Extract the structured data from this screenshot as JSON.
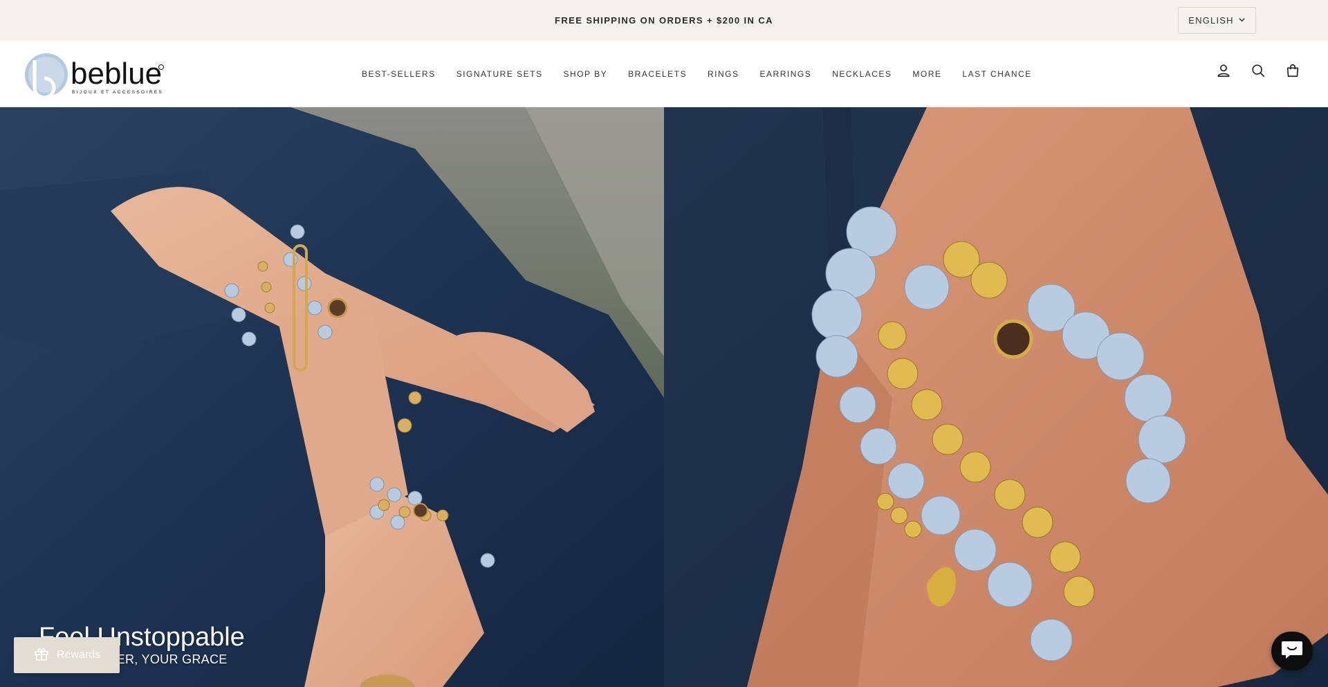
{
  "announcement": {
    "text": "FREE SHIPPING ON ORDERS + $200 IN CA",
    "language": "ENGLISH"
  },
  "header": {
    "logo_text": "beblue",
    "logo_tagline": "BIJOUX ET ACCESSOIRES",
    "nav": [
      "BEST-SELLERS",
      "SIGNATURE SETS",
      "SHOP BY",
      "BRACELETS",
      "RINGS",
      "EARRINGS",
      "NECKLACES",
      "MORE",
      "LAST CHANCE"
    ],
    "icons": [
      "account-icon",
      "search-icon",
      "cart-icon"
    ]
  },
  "hero": {
    "title": "Feel Unstoppable",
    "subtitle": ", YOUR POWER, YOUR GRACE"
  },
  "rewards": {
    "label": "Rewards",
    "icon": "gift-icon"
  },
  "chat": {
    "icon": "chat-icon"
  },
  "colors": {
    "announcement_bg": "#f5f1ec",
    "logo_blue": "#a9c2d8",
    "denim": "#23344f",
    "rewards_bg": "#e2dcd3",
    "chat_bg": "#0d0d0d"
  }
}
